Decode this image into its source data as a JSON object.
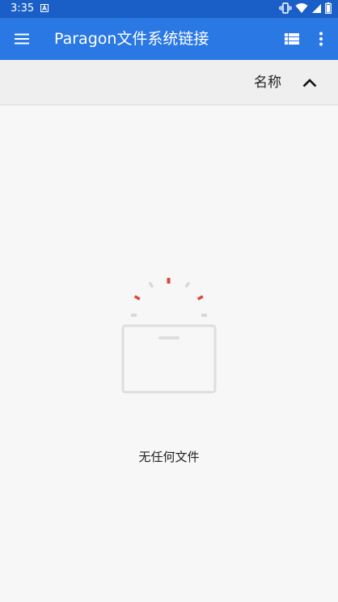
{
  "status_bar": {
    "time": "3:35"
  },
  "app_bar": {
    "title": "Paragon文件系统链接"
  },
  "sort_bar": {
    "label": "名称"
  },
  "empty_state": {
    "message": "无任何文件"
  },
  "icons": {
    "menu": "menu-icon",
    "view": "list-view-icon",
    "more": "more-vert-icon",
    "sort": "chevron-up-icon",
    "empty": "empty-folder-icon"
  },
  "colors": {
    "status_bar": "#1a5fc8",
    "app_bar": "#2a78e4",
    "background": "#f7f7f7",
    "accent_red": "#d9483b"
  }
}
